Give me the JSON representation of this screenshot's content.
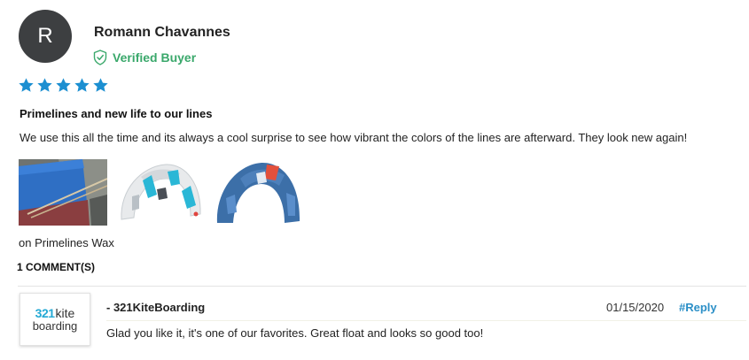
{
  "review": {
    "author_initial": "R",
    "author_name": "Romann Chavannes",
    "verified_label": "Verified Buyer",
    "rating": 5,
    "rating_max": 5,
    "title": "Primelines and new life to our lines",
    "body": "We use this all the time and its always a cool surprise to see how vibrant the colors of the lines are afterward. They look new again!",
    "product_prefix": "on",
    "product_name": "Primelines Wax",
    "comment_count_label": "1 COMMENT(S)"
  },
  "reply": {
    "logo_num": "321",
    "logo_word1": "kite",
    "logo_word2": "boarding",
    "author": "- 321KiteBoarding",
    "date": "01/15/2020",
    "reply_label": "#Reply",
    "body": "Glad you like it, it's one of our favorites. Great float and looks so good too!"
  },
  "colors": {
    "star": "#1c8fd1",
    "verified": "#3aa86b",
    "reply_link": "#2b8fc7",
    "logo_accent": "#24a9d4",
    "avatar_bg": "#3d3f41"
  },
  "icons": {
    "verified": "shield-check-icon",
    "star": "star-icon"
  }
}
